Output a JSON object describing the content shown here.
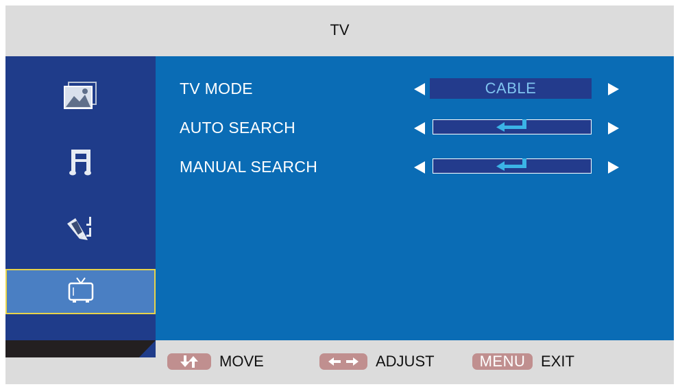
{
  "title": "TV",
  "sidebar": {
    "items": [
      {
        "icon": "picture-icon"
      },
      {
        "icon": "sound-icon"
      },
      {
        "icon": "setup-icon"
      },
      {
        "icon": "tv-icon",
        "selected": true
      }
    ]
  },
  "menu": {
    "rows": [
      {
        "label": "TV MODE",
        "value": "CABLE"
      },
      {
        "label": "AUTO SEARCH",
        "value_icon": "enter-icon"
      },
      {
        "label": "MANUAL SEARCH",
        "value_icon": "enter-icon"
      }
    ]
  },
  "footer": {
    "move_label": "MOVE",
    "adjust_label": "ADJUST",
    "menu_key": "MENU",
    "exit_label": "EXIT"
  },
  "colors": {
    "content_bg": "#0a6cb5",
    "sidebar_bg": "#1f3c8a",
    "selected_bg": "#4a7fc3",
    "selected_border": "#e8d44a",
    "key_bg": "#c08f8f",
    "frame_bg": "#dcdcdc",
    "value_text": "#7fc4ef"
  }
}
